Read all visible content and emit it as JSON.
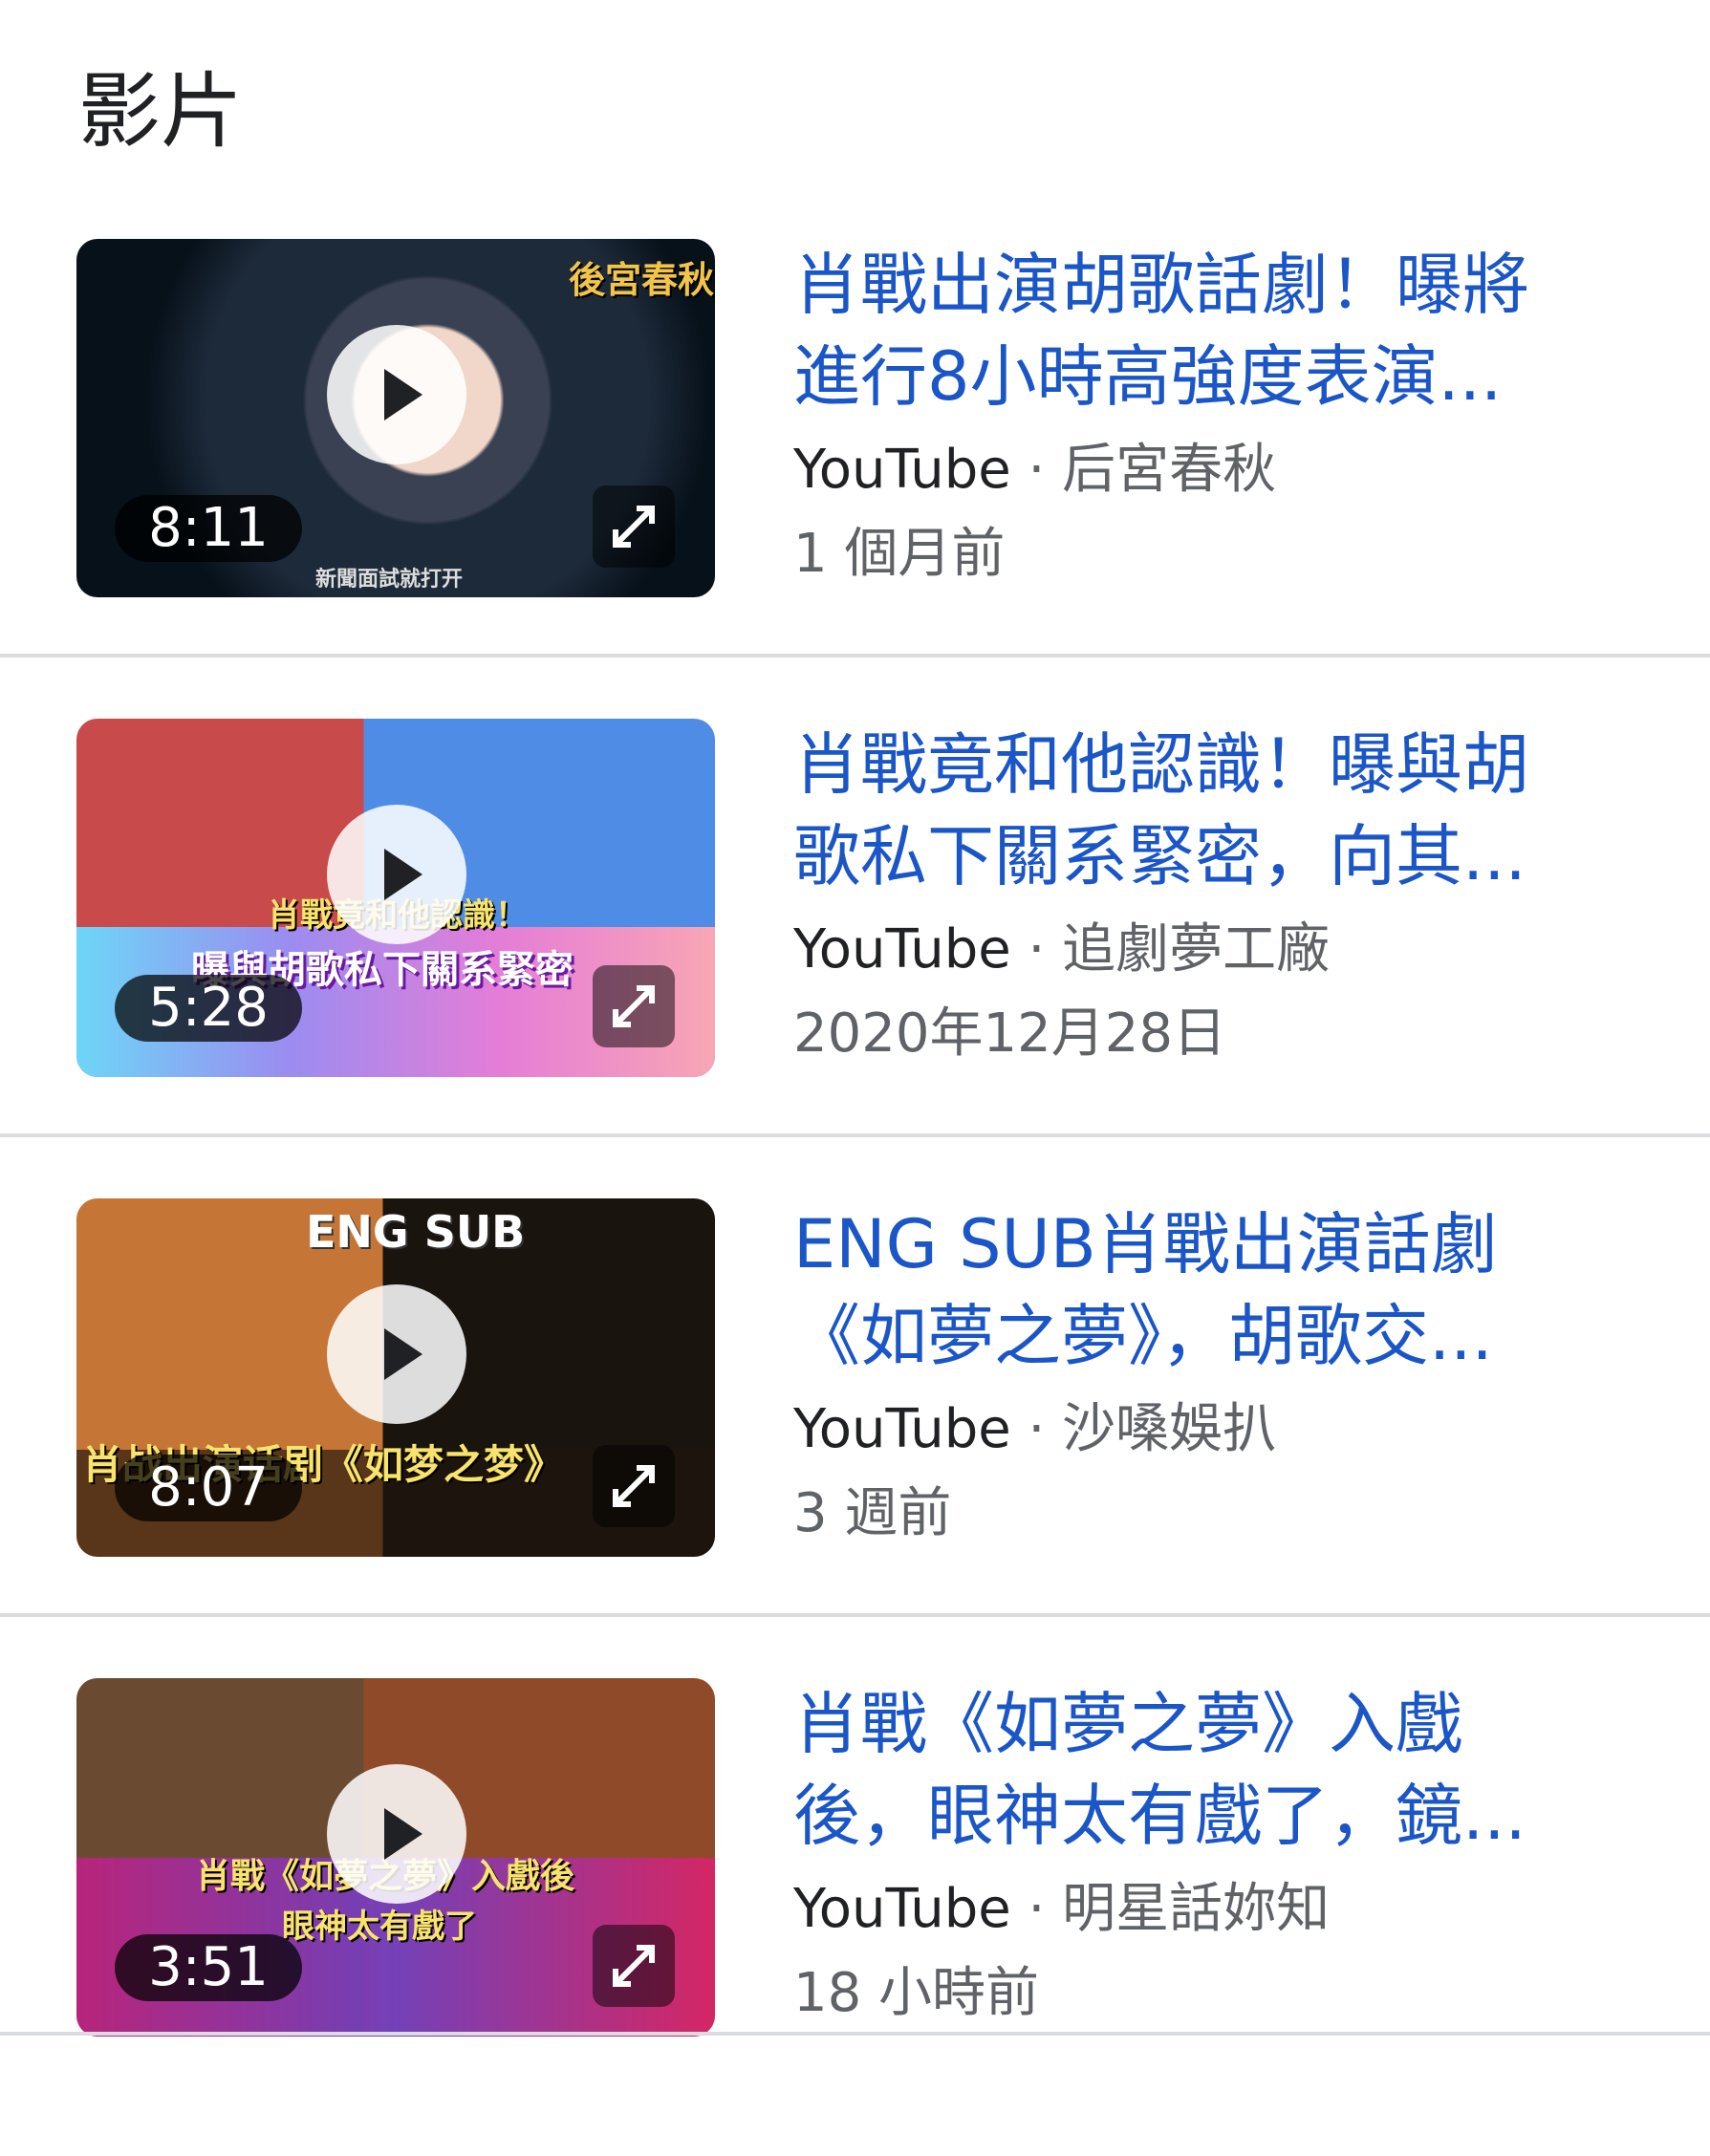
{
  "section": {
    "title": "影片"
  },
  "videos": [
    {
      "title_line1": "肖戰出演胡歌話劇！曝將",
      "title_line2": "進行8小時高強度表演...",
      "source": "YouTube",
      "channel": "后宮春秋",
      "date": "1 個月前",
      "duration": "8:11",
      "thumb_logo": "後宮春秋",
      "thumb_caption": "新聞面試就打开"
    },
    {
      "title_line1": "肖戰竟和他認識！曝與胡",
      "title_line2": "歌私下關系緊密，向其...",
      "source": "YouTube",
      "channel": "追劇夢工廠",
      "date": "2020年12月28日",
      "duration": "5:28",
      "thumb_caption": "肖戰竟和他認識！",
      "thumb_caption2": "曝與胡歌私下關系緊密"
    },
    {
      "title_line1": "ENG SUB肖戰出演話劇",
      "title_line2": "《如夢之夢》，胡歌交...",
      "source": "YouTube",
      "channel": "沙嗓娛扒",
      "date": "3 週前",
      "duration": "8:07",
      "thumb_caption": "ENG SUB",
      "thumb_caption2": "肖战出演话剧《如梦之梦》"
    },
    {
      "title_line1": "肖戰《如夢之夢》入戲",
      "title_line2": "後，眼神太有戲了，鏡...",
      "source": "YouTube",
      "channel": "明星話妳知",
      "date": "18 小時前",
      "duration": "3:51",
      "thumb_caption": "肖戰《如夢之夢》入戲後",
      "thumb_caption2": "眼神太有戲了"
    }
  ],
  "separator": " · "
}
